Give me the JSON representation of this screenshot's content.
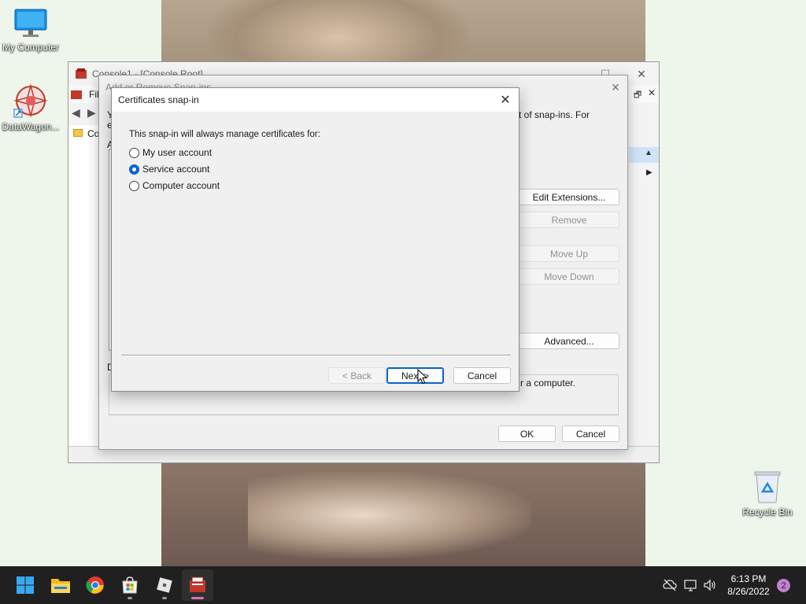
{
  "desktop": {
    "icons": [
      {
        "label": "My Computer"
      },
      {
        "label": "DataWagon..."
      },
      {
        "label": "Recycle Bin"
      }
    ]
  },
  "console_window": {
    "title": "Console1 - [Console Root]",
    "menu_file": "File",
    "tree_item": "Co"
  },
  "snapins_dialog": {
    "title": "Add or Remove Snap-ins",
    "intro_text_right": "t of snap-ins. For",
    "intro_text_left": "Y",
    "intro_text_left2": "e",
    "available_label": "A",
    "desc_label": "D",
    "buttons": {
      "edit_extensions": "Edit Extensions...",
      "remove": "Remove",
      "move_up": "Move Up",
      "move_down": "Move Down",
      "advanced": "Advanced...",
      "ok": "OK",
      "cancel": "Cancel"
    },
    "description_text": "r a computer."
  },
  "cert_dialog": {
    "title": "Certificates snap-in",
    "prompt": "This snap-in will always manage certificates for:",
    "options": [
      {
        "label": "My user account",
        "checked": false
      },
      {
        "label": "Service account",
        "checked": true
      },
      {
        "label": "Computer account",
        "checked": false
      }
    ],
    "buttons": {
      "back": "< Back",
      "next": "Next >",
      "cancel": "Cancel"
    }
  },
  "taskbar": {
    "time": "6:13 PM",
    "date": "8/26/2022",
    "notification_count": "2",
    "apps": [
      "start-icon",
      "file-explorer-icon",
      "chrome-icon",
      "store-icon",
      "roblox-icon",
      "mmc-icon"
    ]
  },
  "colors": {
    "accent": "#0a63c9",
    "taskbar": "#202020",
    "badge": "#c47fd0"
  }
}
